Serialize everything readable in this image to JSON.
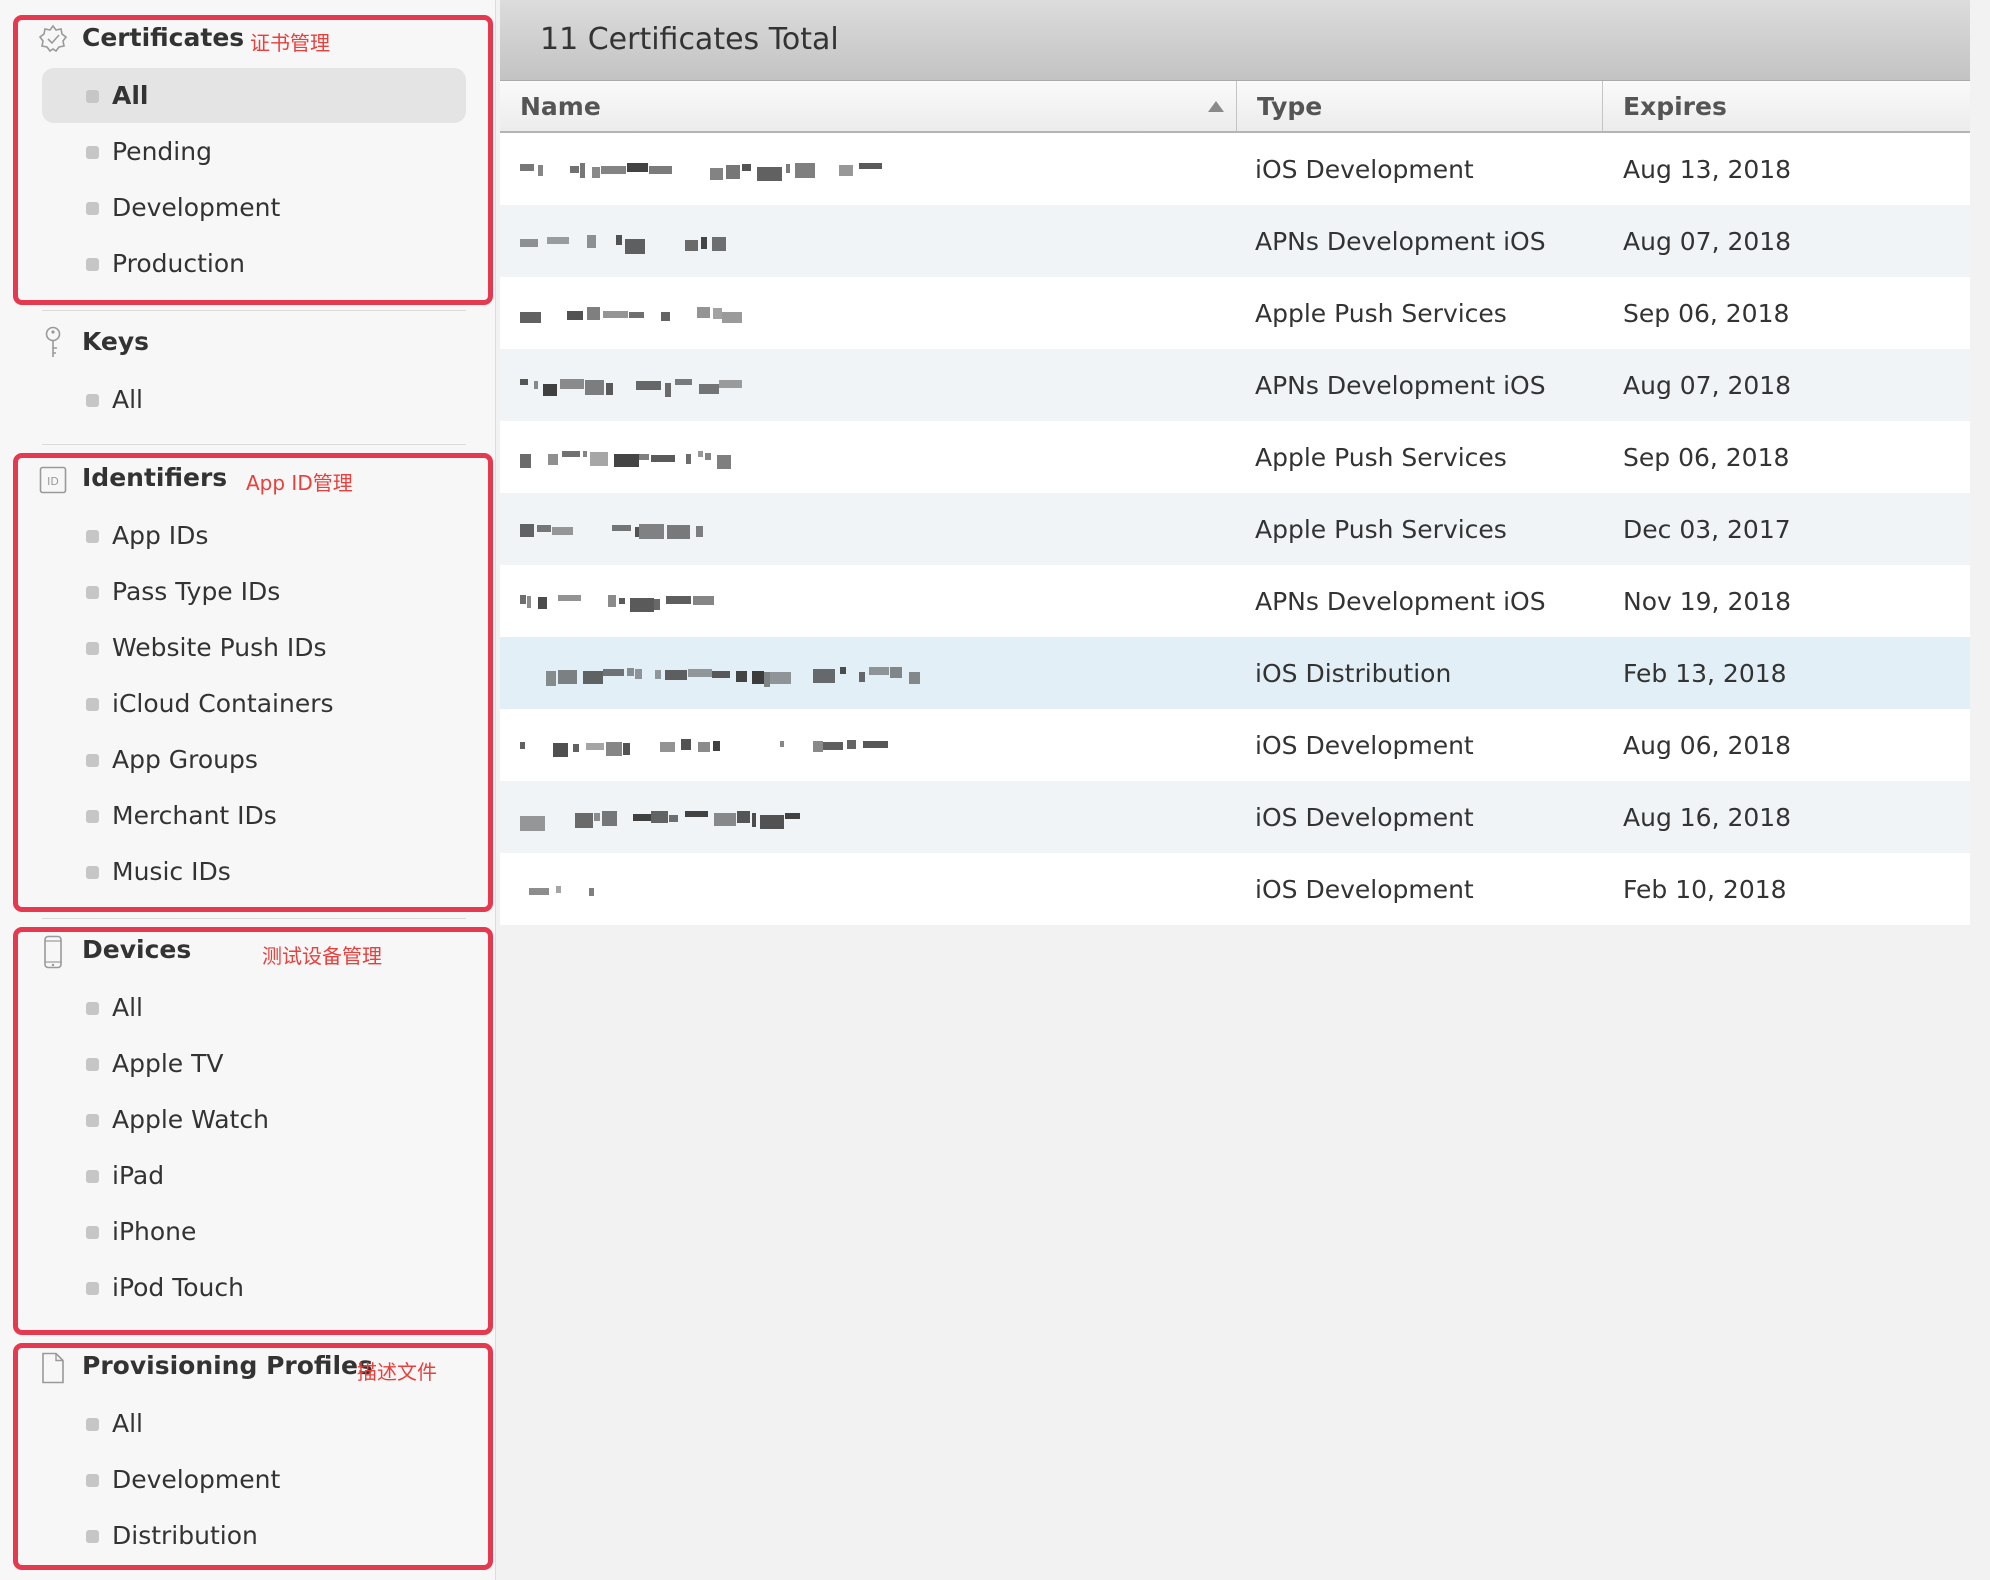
{
  "sidebar": {
    "certificates": {
      "title": "Certificates",
      "annotation": "证书管理",
      "icon": "certificate-badge-icon",
      "items": [
        "All",
        "Pending",
        "Development",
        "Production"
      ],
      "selected": "All"
    },
    "keys": {
      "title": "Keys",
      "icon": "key-icon",
      "items": [
        "All"
      ]
    },
    "identifiers": {
      "title": "Identifiers",
      "annotation": "App ID管理",
      "icon": "id-icon",
      "items": [
        "App IDs",
        "Pass Type IDs",
        "Website Push IDs",
        "iCloud Containers",
        "App Groups",
        "Merchant IDs",
        "Music IDs"
      ]
    },
    "devices": {
      "title": "Devices",
      "annotation": "测试设备管理",
      "icon": "phone-icon",
      "items": [
        "All",
        "Apple TV",
        "Apple Watch",
        "iPad",
        "iPhone",
        "iPod Touch"
      ]
    },
    "profiles": {
      "title": "Provisioning Profiles",
      "annotation": "描述文件",
      "icon": "document-icon",
      "items": [
        "All",
        "Development",
        "Distribution"
      ]
    }
  },
  "main": {
    "title": "11 Certificates Total",
    "columns": {
      "name": "Name",
      "type": "Type",
      "expires": "Expires"
    },
    "sort": "name-ascending",
    "rows": [
      {
        "name": "",
        "type": "iOS Development",
        "expires": "Aug 13, 2018"
      },
      {
        "name": "",
        "type": "APNs Development iOS",
        "expires": "Aug 07, 2018"
      },
      {
        "name": "",
        "type": "Apple Push Services",
        "expires": "Sep 06, 2018"
      },
      {
        "name": "",
        "type": "APNs Development iOS",
        "expires": "Aug 07, 2018"
      },
      {
        "name": "",
        "type": "Apple Push Services",
        "expires": "Sep 06, 2018"
      },
      {
        "name": "",
        "type": "Apple Push Services",
        "expires": "Dec 03, 2017"
      },
      {
        "name": "",
        "type": "APNs Development iOS",
        "expires": "Nov 19, 2018"
      },
      {
        "name": "",
        "type": "iOS Distribution",
        "expires": "Feb 13, 2018"
      },
      {
        "name": "",
        "type": "iOS Development",
        "expires": "Aug 06, 2018"
      },
      {
        "name": "",
        "type": "iOS Development",
        "expires": "Aug 16, 2018"
      },
      {
        "name": "",
        "type": "iOS Development",
        "expires": "Feb 10, 2018"
      }
    ]
  },
  "colors": {
    "annotation_red": "#e4394f",
    "sidebar_bg": "#f7f7f7",
    "header_gray": "#c8c8c8",
    "row_alt": "#f1f4f7",
    "row_highlight": "#e3eff6"
  }
}
